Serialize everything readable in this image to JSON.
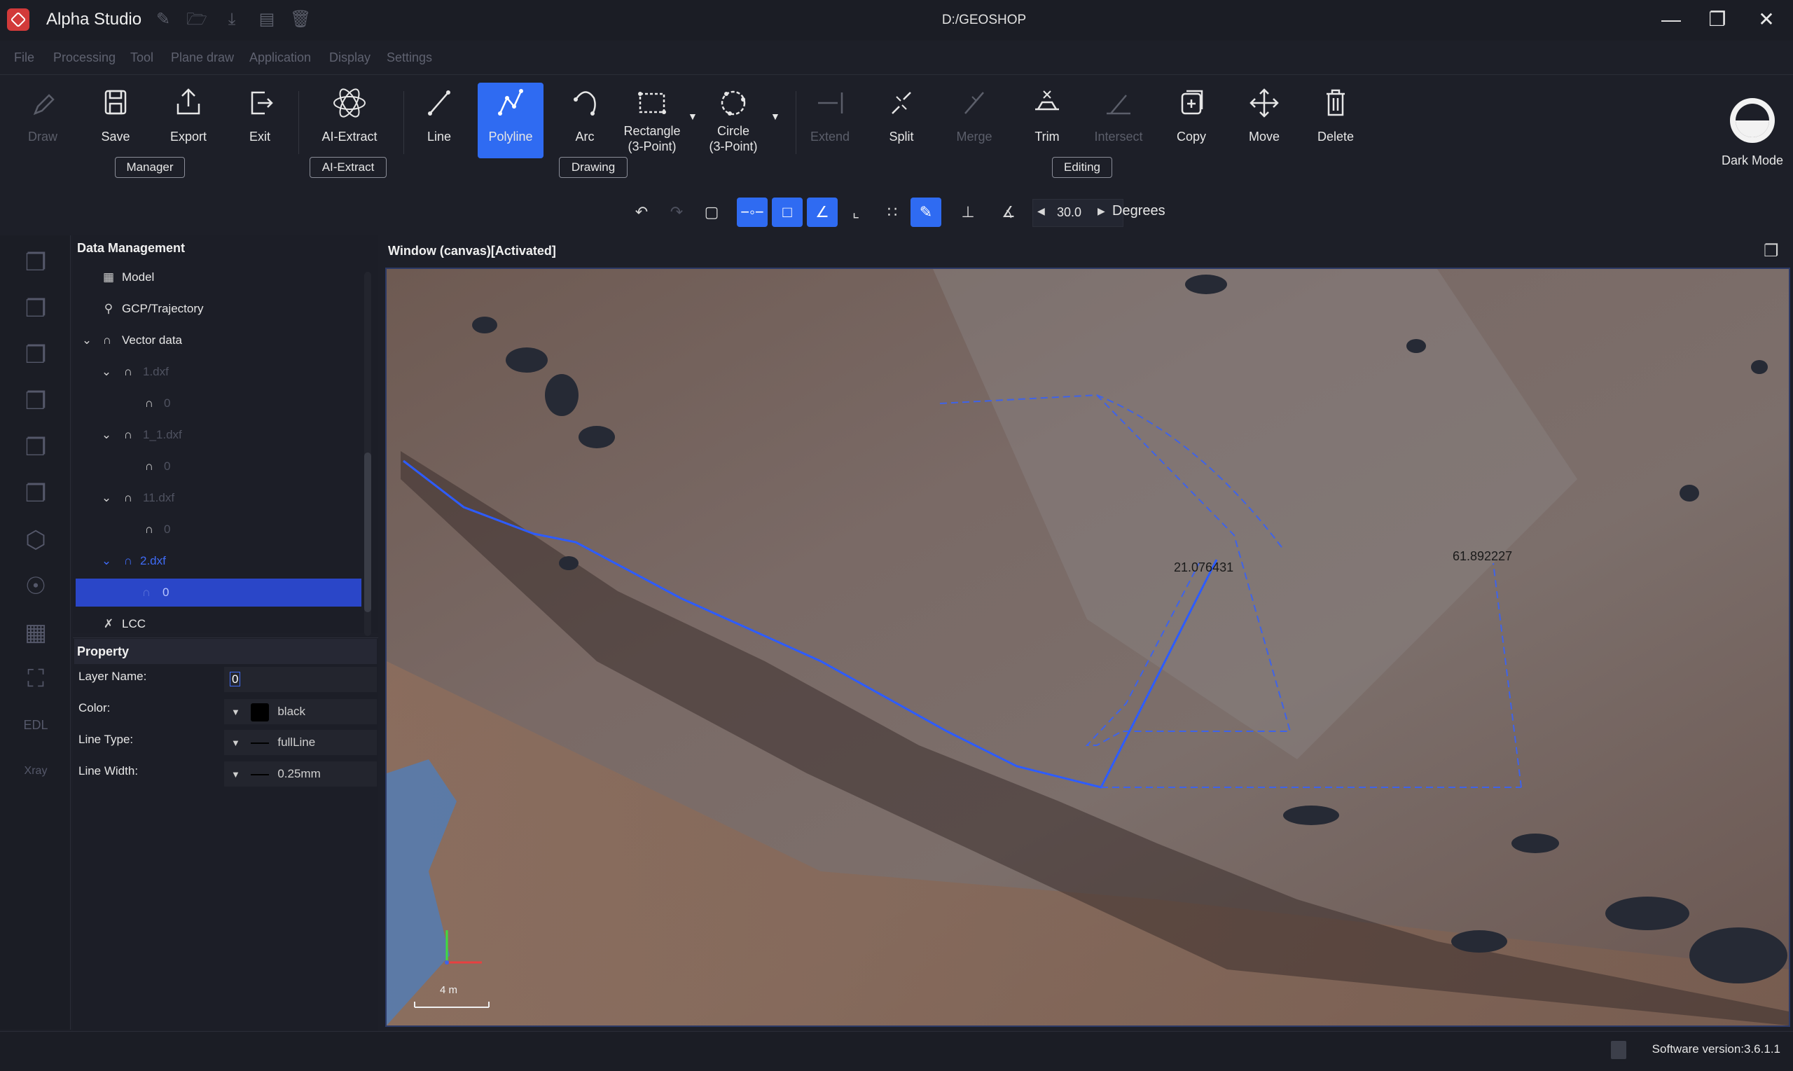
{
  "app": {
    "title": "Alpha Studio",
    "path": "D:/GEOSHOP"
  },
  "menu": [
    "File",
    "Processing",
    "Tool",
    "Plane draw",
    "Application",
    "Display",
    "Settings"
  ],
  "ribbon": {
    "draw": "Draw",
    "save": "Save",
    "export": "Export",
    "exit": "Exit",
    "ai_extract": "AI-Extract",
    "line": "Line",
    "polyline": "Polyline",
    "arc": "Arc",
    "rectangle_1": "Rectangle",
    "rectangle_2": "(3-Point)",
    "circle_1": "Circle",
    "circle_2": "(3-Point)",
    "extend": "Extend",
    "split": "Split",
    "merge": "Merge",
    "trim": "Trim",
    "intersect": "Intersect",
    "copy": "Copy",
    "move": "Move",
    "delete": "Delete",
    "dark_mode": "Dark Mode",
    "groups": {
      "manager": "Manager",
      "ai_extract": "AI-Extract",
      "drawing": "Drawing",
      "editing": "Editing"
    }
  },
  "snap_toolbar": {
    "angle_value": "30.0",
    "angle_unit": "Degrees"
  },
  "data_management": {
    "header": "Data Management",
    "items": {
      "model": "Model",
      "gcp": "GCP/Trajectory",
      "vector": "Vector data",
      "f1": "1.dxf",
      "f1_layer": "0",
      "f2": "1_1.dxf",
      "f2_layer": "0",
      "f3": "11.dxf",
      "f3_layer": "0",
      "f4": "2.dxf",
      "f4_layer": "0",
      "lcc": "LCC"
    }
  },
  "property": {
    "header": "Property",
    "layer_name_label": "Layer Name:",
    "layer_name_value": "0",
    "color_label": "Color:",
    "color_value": "black",
    "line_type_label": "Line Type:",
    "line_type_value": "fullLine",
    "line_width_label": "Line Width:",
    "line_width_value": "0.25mm"
  },
  "canvas": {
    "header": "Window (canvas)[Activated]",
    "measure_1": "21.076431",
    "measure_2": "61.892227",
    "scale_label": "4 m"
  },
  "status": {
    "version": "Software version:3.6.1.1"
  },
  "colors": {
    "accent": "#2f6bf2",
    "background": "#1d1f28",
    "drawn_line": "#2d5cff"
  }
}
